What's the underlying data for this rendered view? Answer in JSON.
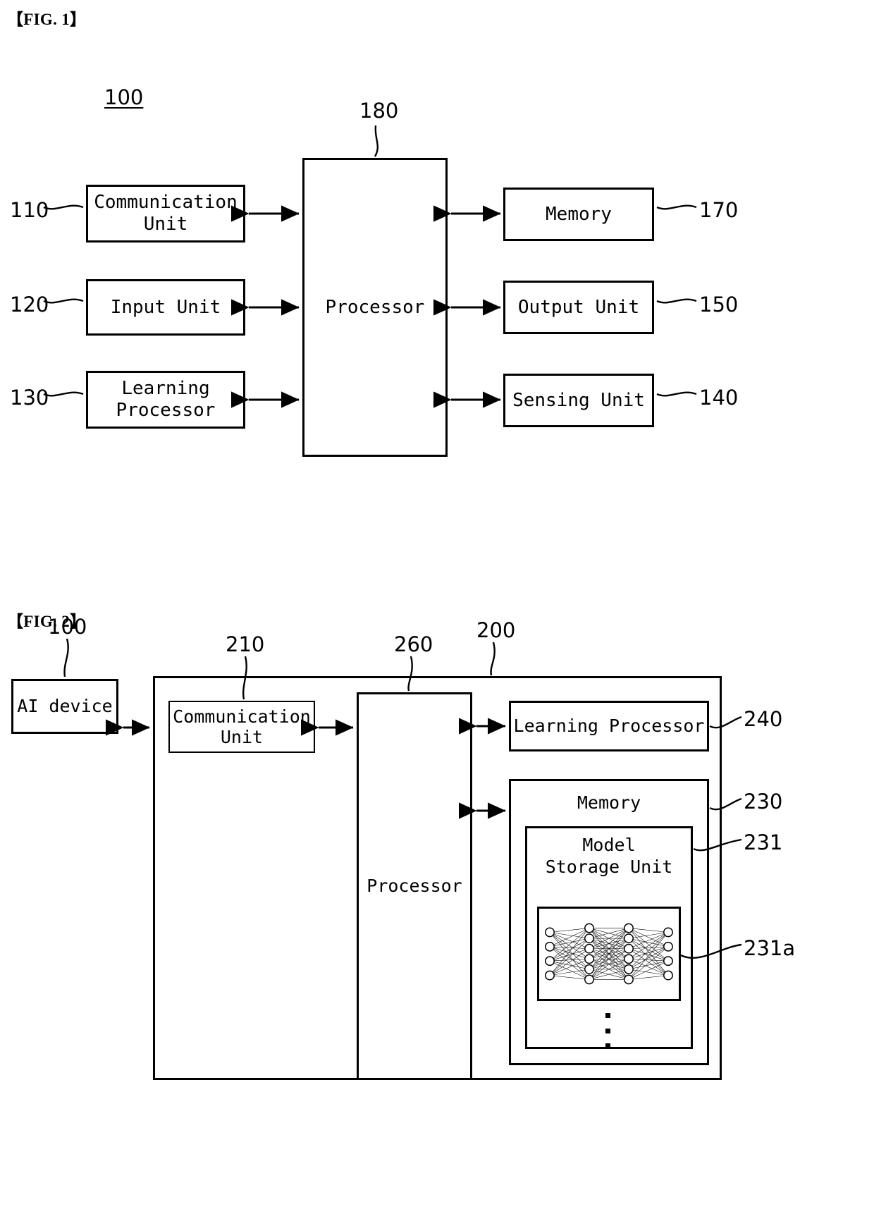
{
  "figures": [
    {
      "caption": "【FIG. 1】",
      "system_ref": "100",
      "blocks": [
        {
          "name": "communication-unit",
          "label": "Communication\nUnit",
          "ref": "110"
        },
        {
          "name": "input-unit",
          "label": "Input Unit",
          "ref": "120"
        },
        {
          "name": "learning-processor",
          "label": "Learning\nProcessor",
          "ref": "130"
        },
        {
          "name": "processor",
          "label": "Processor",
          "ref": "180"
        },
        {
          "name": "memory",
          "label": "Memory",
          "ref": "170"
        },
        {
          "name": "output-unit",
          "label": "Output Unit",
          "ref": "150"
        },
        {
          "name": "sensing-unit",
          "label": "Sensing Unit",
          "ref": "140"
        }
      ]
    },
    {
      "caption": "【FIG. 2】",
      "system_ref": "200",
      "blocks": [
        {
          "name": "ai-device",
          "label": "AI device",
          "ref": "100"
        },
        {
          "name": "communication-unit",
          "label": "Communication\nUnit",
          "ref": "210"
        },
        {
          "name": "processor",
          "label": "Processor",
          "ref": "260"
        },
        {
          "name": "learning-processor",
          "label": "Learning Processor",
          "ref": "240"
        },
        {
          "name": "memory",
          "label": "Memory",
          "ref": "230"
        },
        {
          "name": "model-storage-unit",
          "label": "Model\nStorage Unit",
          "ref": "231"
        },
        {
          "name": "neural-network",
          "label": "",
          "ref": "231a"
        }
      ]
    }
  ],
  "fig1": {
    "caption": "【FIG. 1】",
    "system_ref": "100",
    "left": [
      {
        "ref": "110",
        "label": "Communication\nUnit"
      },
      {
        "ref": "120",
        "label": "Input Unit"
      },
      {
        "ref": "130",
        "label": "Learning\nProcessor"
      }
    ],
    "center": {
      "ref": "180",
      "label": "Processor"
    },
    "right": [
      {
        "ref": "170",
        "label": "Memory"
      },
      {
        "ref": "150",
        "label": "Output Unit"
      },
      {
        "ref": "140",
        "label": "Sensing Unit"
      }
    ]
  },
  "fig2": {
    "caption": "【FIG. 2】",
    "ai_device": {
      "ref": "100",
      "label": "AI device"
    },
    "server": {
      "ref": "200"
    },
    "communication_unit": {
      "ref": "210",
      "label": "Communication\nUnit"
    },
    "processor": {
      "ref": "260",
      "label": "Processor"
    },
    "learning_processor": {
      "ref": "240",
      "label": "Learning Processor"
    },
    "memory": {
      "ref": "230",
      "label": "Memory"
    },
    "model_storage_unit": {
      "ref": "231",
      "label": "Model\nStorage Unit"
    },
    "neural_network": {
      "ref": "231a"
    }
  },
  "neural_network_layers": [
    4,
    6,
    6,
    4
  ],
  "vertical_ellipsis_dots": 3
}
